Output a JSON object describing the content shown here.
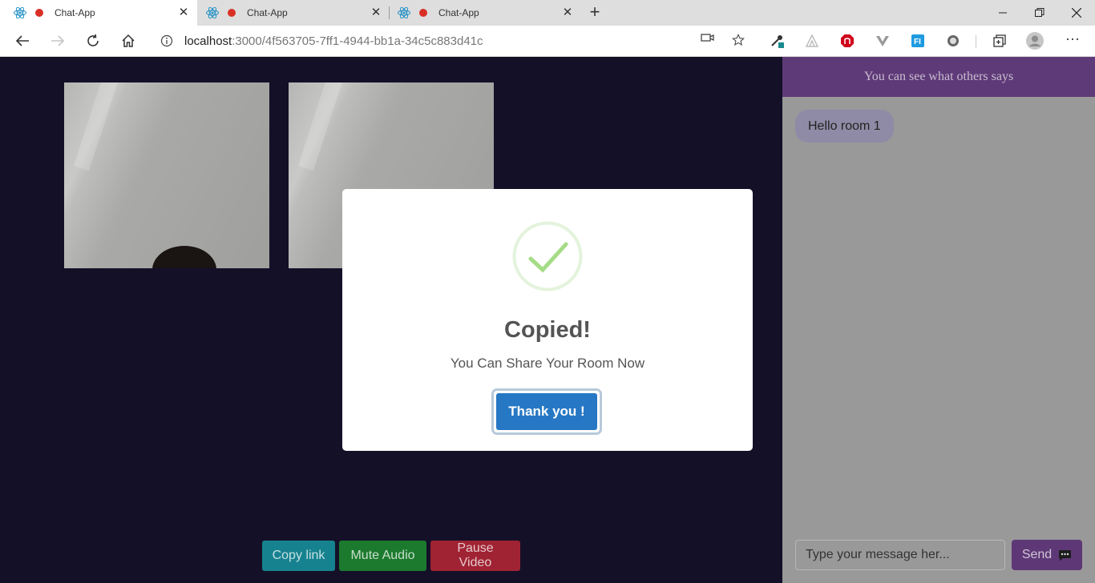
{
  "browser": {
    "tabs": [
      {
        "title": "Chat-App"
      },
      {
        "title": "Chat-App"
      },
      {
        "title": "Chat-App"
      }
    ],
    "url_host": "localhost",
    "url_path": ":3000/4f563705-7ff1-4944-bb1a-34c5c883d41c"
  },
  "controls": {
    "copy_link": "Copy link",
    "mute_audio": "Mute Audio",
    "pause_video": "Pause Video"
  },
  "chat": {
    "header": "You can see what others says",
    "messages": [
      {
        "text": "Hello room 1"
      }
    ],
    "input_placeholder": "Type your message her...",
    "send_label": "Send"
  },
  "modal": {
    "title": "Copied!",
    "text": "You Can Share Your Room Now",
    "confirm_label": "Thank you !"
  },
  "colors": {
    "page_bg": "#141028",
    "chat_header": "#5f3a78",
    "copy_btn": "#17828f",
    "mute_btn": "#1c7a2e",
    "pause_btn": "#a02333",
    "confirm_btn": "#2778c4",
    "success": "#a5dc86"
  }
}
